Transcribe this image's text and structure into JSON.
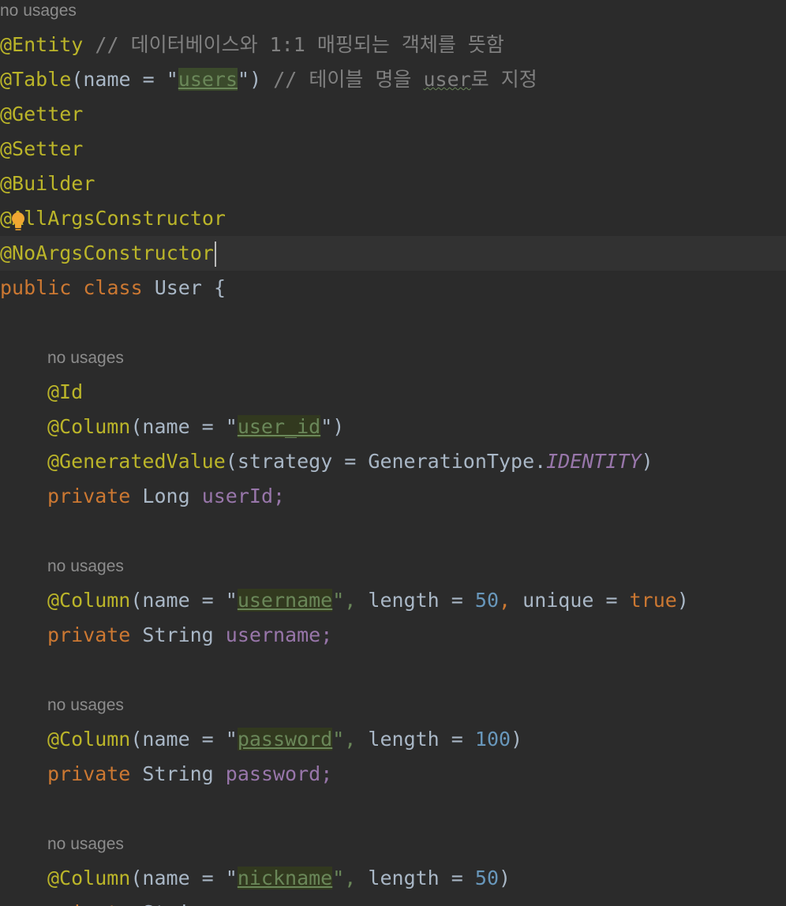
{
  "editor": {
    "hint_label": "no usages",
    "class_block": {
      "entity_annotation": "@Entity",
      "entity_comment": "// 데이터베이스와 1:1 매핑되는 객체를 뜻함",
      "table_annotation": "@Table",
      "table_open": "(name = \"",
      "table_value": "users",
      "table_close": "\")",
      "table_comment_before": "// 테이블 명을 ",
      "table_comment_flagged": "user",
      "table_comment_after": "로 지정",
      "getter": "@Getter",
      "setter": "@Setter",
      "builder": "@Builder",
      "all_args": "@AllArgsConstructor",
      "no_args": "@NoArgsConstructor",
      "kw_public": "public",
      "kw_class": "class",
      "class_name": "User",
      "open_brace": "{"
    },
    "fields": {
      "id_annotation": "@Id",
      "column_annotation": "@Column",
      "column_open": "(name = \"",
      "user_id_value": "user_id",
      "quote_paren": "\")",
      "quote_comma": "\",",
      "generated_annotation": "@GeneratedValue",
      "generated_open": "(strategy = GenerationType.",
      "generated_constant": "IDENTITY",
      "paren_close": ")",
      "kw_private": "private",
      "type_long": "Long",
      "user_id_field": "userId;",
      "username_value": "username",
      "length_label": "length =",
      "length_50": "50",
      "comma": ",",
      "unique_label": "unique =",
      "kw_true": "true",
      "type_string": "String",
      "username_field": "username;",
      "password_value": "password",
      "length_100": "100",
      "password_field": "password;",
      "nickname_value": "nickname"
    }
  }
}
